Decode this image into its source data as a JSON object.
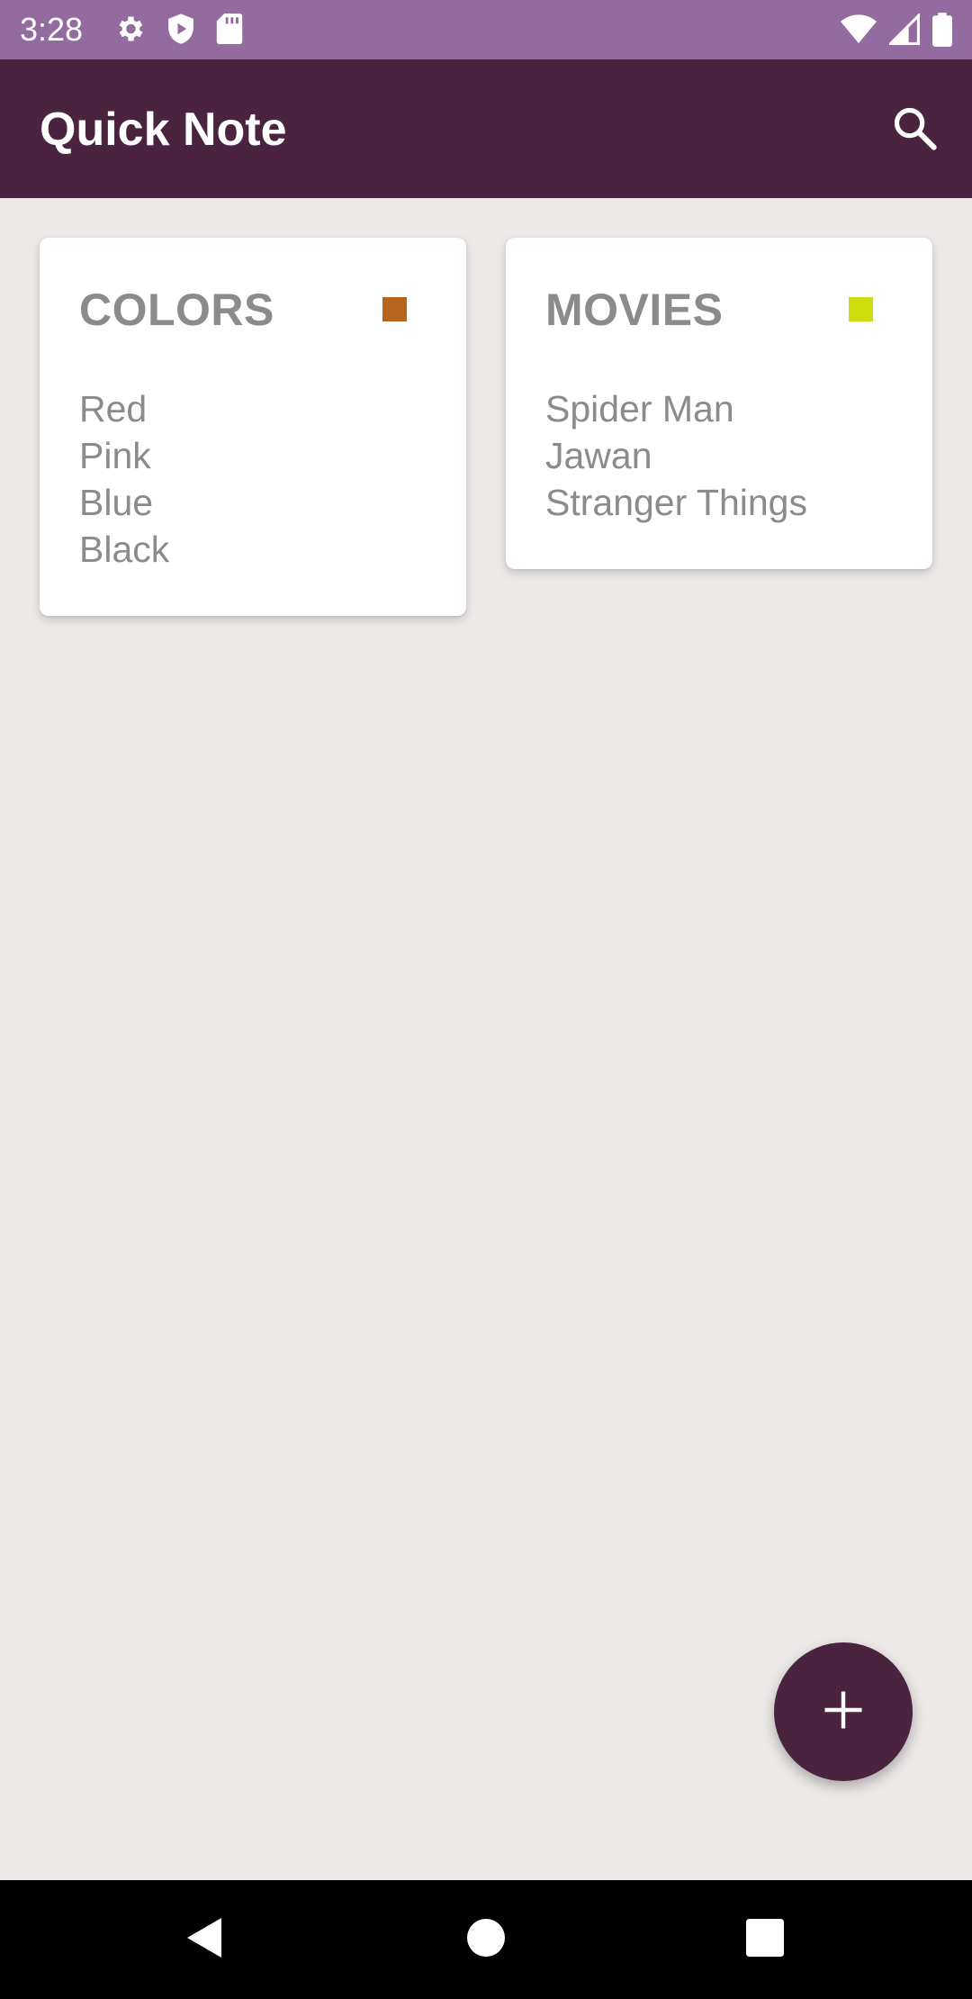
{
  "status_bar": {
    "time": "3:28",
    "left_icons": [
      "gear-icon",
      "shield-play-icon",
      "sd-card-icon"
    ],
    "right_icons": [
      "wifi-icon",
      "signal-icon",
      "battery-icon"
    ]
  },
  "app_bar": {
    "title": "Quick Note",
    "search_icon": "search-icon"
  },
  "notes": [
    {
      "title": "COLORS",
      "color": "#b5651d",
      "lines": [
        "Red",
        "Pink",
        "Blue",
        "Black"
      ]
    },
    {
      "title": "MOVIES",
      "color": "#cddc0c",
      "lines": [
        "Spider Man",
        "Jawan",
        "Stranger Things"
      ]
    }
  ],
  "fab": {
    "icon": "plus-icon"
  },
  "nav_bar": {
    "buttons": [
      "back-icon",
      "home-icon",
      "recents-icon"
    ]
  },
  "theme": {
    "status_bar_color": "#946b9f",
    "app_bar_color": "#4a233f",
    "background_color": "#ece8e7",
    "card_text_color": "#8c8a8c"
  }
}
